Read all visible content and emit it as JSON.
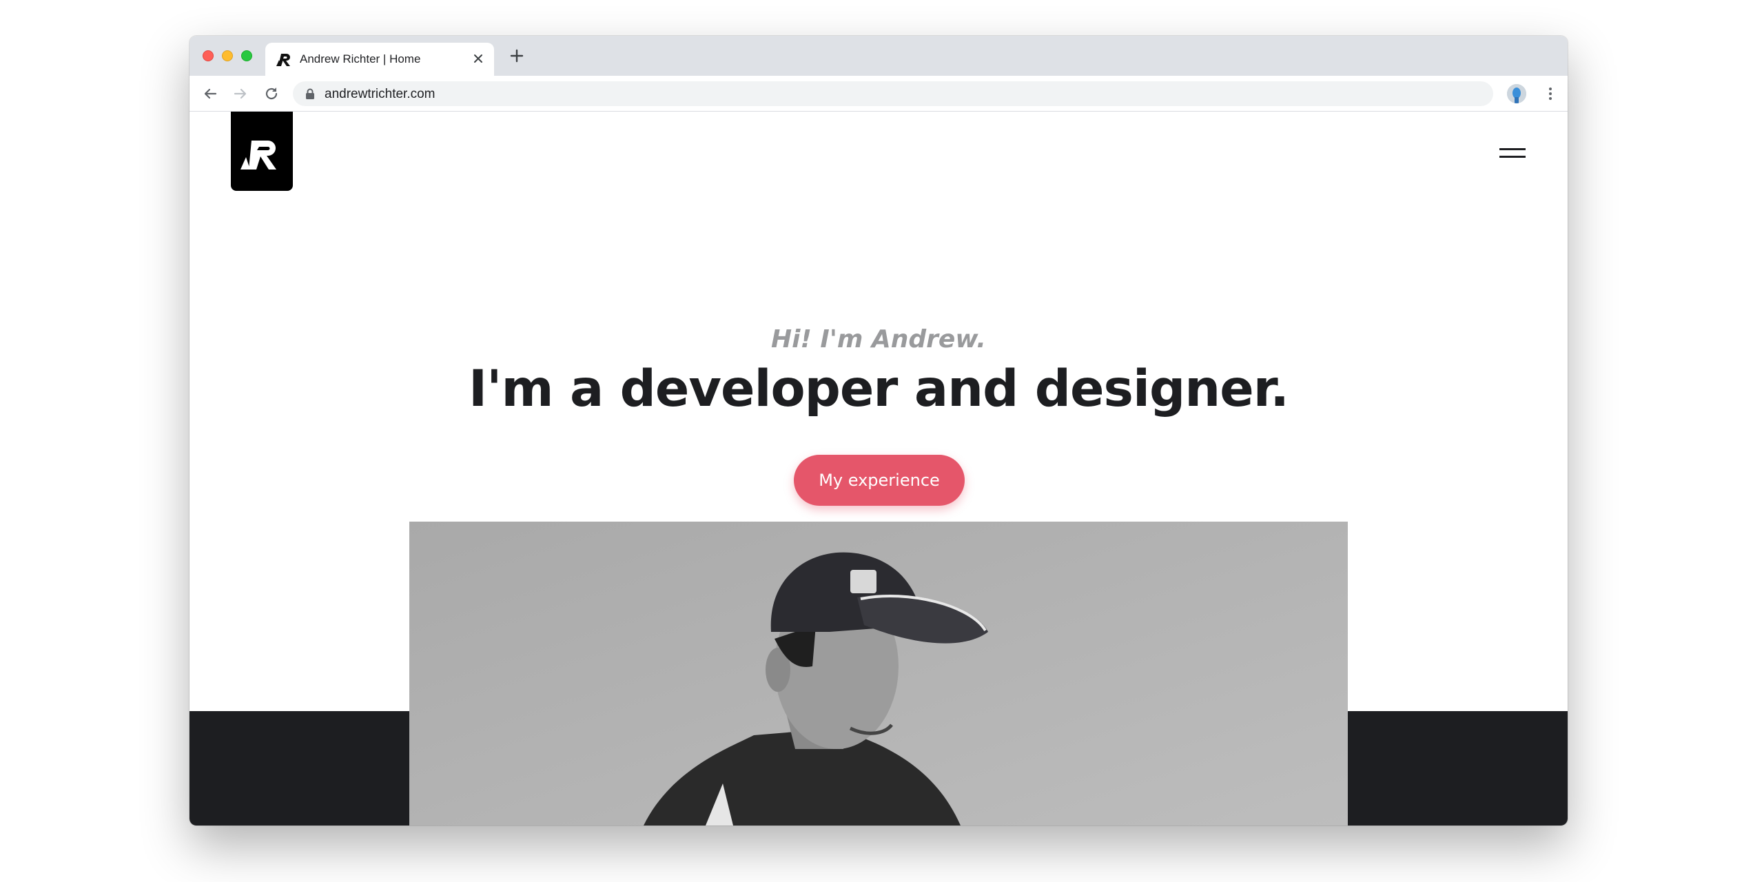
{
  "browser": {
    "tab_title": "Andrew Richter | Home",
    "url": "andrewtrichter.com"
  },
  "site": {
    "logo_text": "AR",
    "greeting": "Hi! I'm Andrew.",
    "headline": "I'm a developer and designer.",
    "cta_label": "My experience"
  },
  "icons": {
    "back": "arrow-left-icon",
    "forward": "arrow-right-icon",
    "reload": "reload-icon",
    "lock": "lock-icon",
    "bookmark": "star-icon",
    "profile": "avatar",
    "menu": "more-vert-icon",
    "hamburger": "hamburger-menu-icon"
  },
  "colors": {
    "accent": "#e5566a",
    "dark": "#1d1e21",
    "greeting_gray": "#999a9c",
    "bookmark_blue": "#1a73e8"
  }
}
